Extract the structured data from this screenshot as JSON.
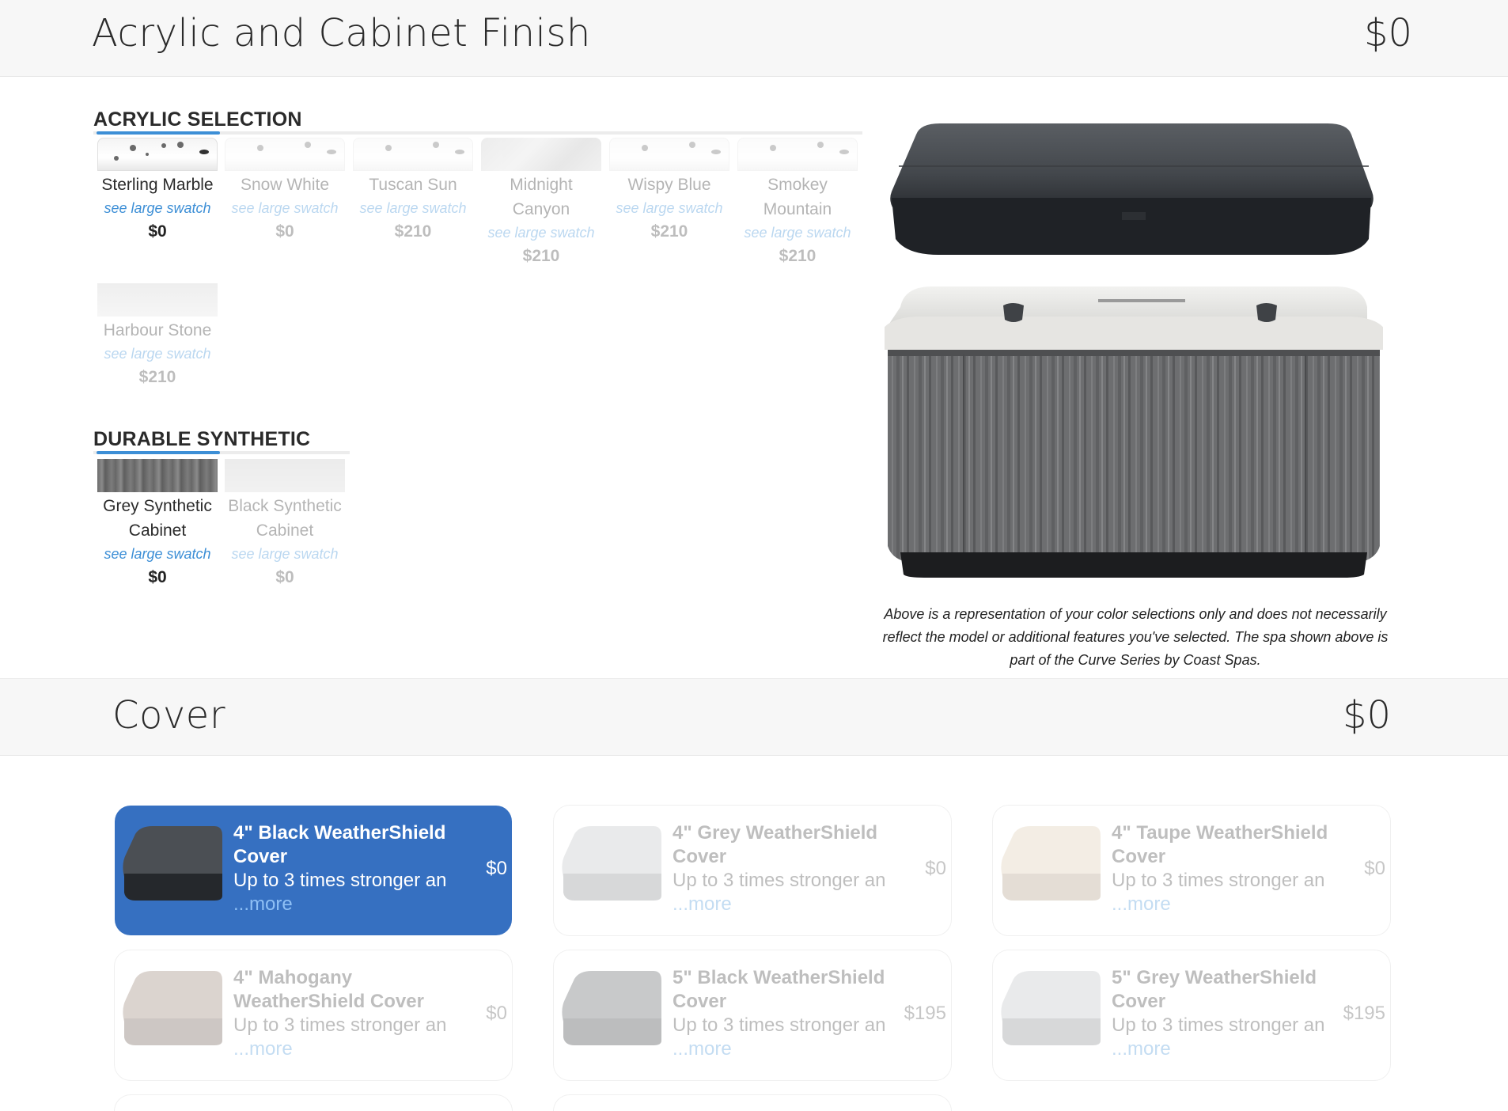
{
  "acrylic_section": {
    "title": "Acrylic and Cabinet Finish",
    "price": "$0"
  },
  "acrylic_selection": {
    "heading": "ACRYLIC SELECTION",
    "options": [
      {
        "name": "Sterling Marble",
        "link": "see large swatch",
        "price": "$0",
        "selected": true
      },
      {
        "name": "Snow White",
        "link": "see large swatch",
        "price": "$0",
        "selected": false
      },
      {
        "name": "Tuscan Sun",
        "link": "see large swatch",
        "price": "$210",
        "selected": false
      },
      {
        "name": "Midnight Canyon",
        "link": "see large swatch",
        "price": "$210",
        "selected": false
      },
      {
        "name": "Wispy Blue",
        "link": "see large swatch",
        "price": "$210",
        "selected": false
      },
      {
        "name": "Smokey Mountain",
        "link": "see large swatch",
        "price": "$210",
        "selected": false
      },
      {
        "name": "Harbour Stone",
        "link": "see large swatch",
        "price": "$210",
        "selected": false
      }
    ]
  },
  "durable_synthetic": {
    "heading": "DURABLE SYNTHETIC",
    "options": [
      {
        "name": "Grey Synthetic Cabinet",
        "link": "see large swatch",
        "price": "$0",
        "selected": true
      },
      {
        "name": "Black Synthetic Cabinet",
        "link": "see large swatch",
        "price": "$0",
        "selected": false
      }
    ]
  },
  "preview": {
    "caption": "Above is a representation of your color selections only and does not necessarily reflect the model or additional features you've selected. The spa shown above is part of the Curve Series by Coast Spas."
  },
  "cover_section": {
    "title": "Cover",
    "price": "$0",
    "options": [
      {
        "title": "4\" Black WeatherShield Cover",
        "desc": "Up to 3 times stronger an",
        "more": "...more",
        "price": "$0",
        "selected": true
      },
      {
        "title": "4\" Grey WeatherShield Cover",
        "desc": "Up to 3 times stronger an",
        "more": "...more",
        "price": "$0",
        "selected": false
      },
      {
        "title": "4\" Taupe WeatherShield Cover",
        "desc": "Up to 3 times stronger an",
        "more": "...more",
        "price": "$0",
        "selected": false
      },
      {
        "title": "4\" Mahogany WeatherShield Cover",
        "desc": "Up to 3 times stronger an",
        "more": "...more",
        "price": "$0",
        "selected": false
      },
      {
        "title": "5\" Black WeatherShield Cover",
        "desc": "Up to 3 times stronger an",
        "more": "...more",
        "price": "$195",
        "selected": false
      },
      {
        "title": "5\" Grey WeatherShield Cover",
        "desc": "Up to 3 times stronger an",
        "more": "...more",
        "price": "$195",
        "selected": false
      }
    ]
  },
  "colors": {
    "accent": "#3d8fd6",
    "selected_card": "#3670c1",
    "header_bg": "#f7f7f7"
  }
}
